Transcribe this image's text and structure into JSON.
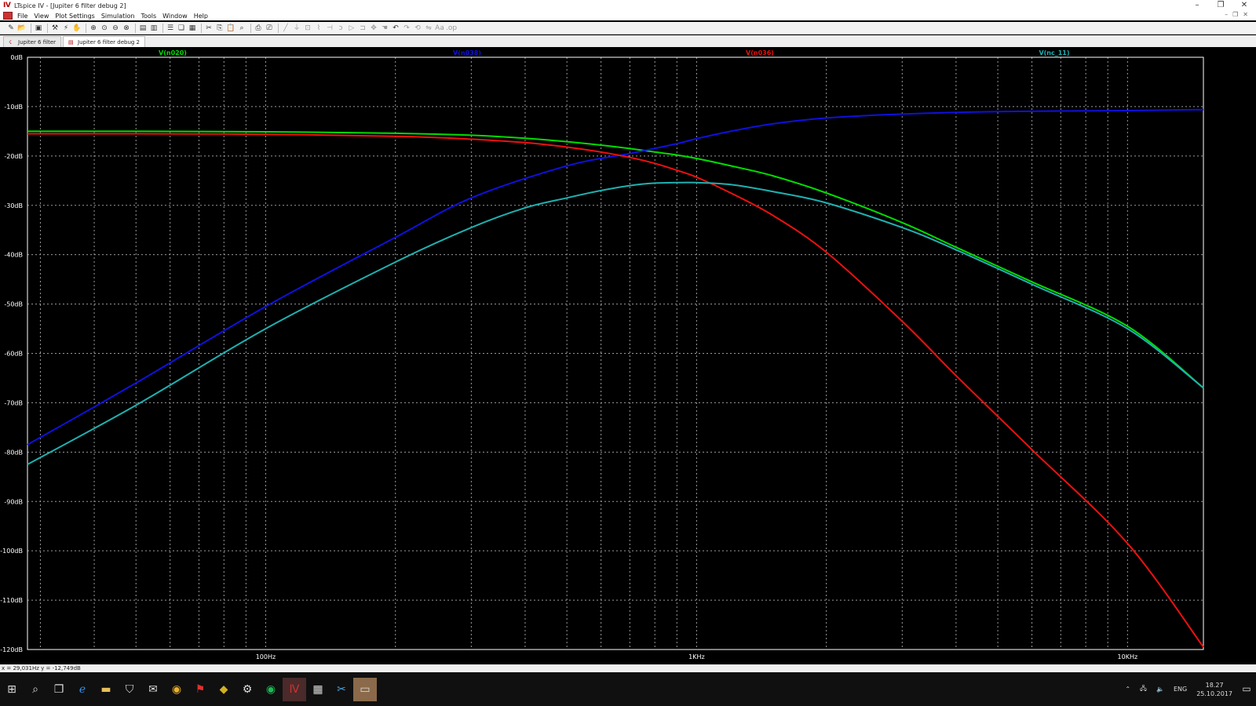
{
  "window": {
    "title": "LTspice IV - [Jupiter 6 filter debug 2]",
    "minimize": "–",
    "restore": "❐",
    "close": "✕"
  },
  "menu": [
    "File",
    "View",
    "Plot Settings",
    "Simulation",
    "Tools",
    "Window",
    "Help"
  ],
  "tabs": [
    {
      "label": "Jupiter 6 filter",
      "active": false
    },
    {
      "label": "Jupiter 6 filter debug 2",
      "active": true
    }
  ],
  "status": "x = 29,031Hz   y = -12,749dB",
  "taskbar": {
    "lang": "ENG",
    "time": "18.27",
    "date": "25.10.2017"
  },
  "chart_data": {
    "type": "line",
    "xscale": "log",
    "xlim": [
      28,
      15000
    ],
    "ylim": [
      -120,
      0
    ],
    "grid": true,
    "background": "#000000",
    "y_ticks": [
      "0dB",
      "-10dB",
      "-20dB",
      "-30dB",
      "-40dB",
      "-50dB",
      "-60dB",
      "-70dB",
      "-80dB",
      "-90dB",
      "-100dB",
      "-110dB",
      "-120dB"
    ],
    "y_tick_values": [
      0,
      -10,
      -20,
      -30,
      -40,
      -50,
      -60,
      -70,
      -80,
      -90,
      -100,
      -110,
      -120
    ],
    "x_ticks": [
      "100Hz",
      "1KHz",
      "10KHz"
    ],
    "x_tick_values": [
      100,
      1000,
      10000
    ],
    "series": [
      {
        "name": "V(n020)",
        "color": "#00dd00",
        "x": [
          28,
          50,
          100,
          200,
          300,
          400,
          500,
          600,
          700,
          800,
          900,
          1000,
          1200,
          1500,
          2000,
          3000,
          4000,
          6000,
          10000,
          15000
        ],
        "y": [
          -15.0,
          -15.0,
          -15.1,
          -15.4,
          -15.8,
          -16.4,
          -17.1,
          -17.8,
          -18.5,
          -19.2,
          -19.8,
          -20.5,
          -22.0,
          -24.0,
          -27.5,
          -33.5,
          -38.5,
          -45.5,
          -54.5,
          -67.0
        ]
      },
      {
        "name": "V(n038)",
        "color": "#1010dd",
        "x": [
          28,
          50,
          100,
          200,
          300,
          500,
          700,
          900,
          1000,
          1200,
          1500,
          2000,
          3000,
          5000,
          10000,
          15000
        ],
        "y": [
          -78.5,
          -66.0,
          -50.5,
          -36.5,
          -28.5,
          -22.0,
          -19.5,
          -17.5,
          -16.5,
          -15.0,
          -13.5,
          -12.3,
          -11.5,
          -11.0,
          -10.8,
          -10.6
        ]
      },
      {
        "name": "V(n036)",
        "color": "#ee1010",
        "x": [
          28,
          50,
          100,
          200,
          300,
          400,
          500,
          600,
          700,
          800,
          900,
          1000,
          1200,
          1500,
          2000,
          3000,
          4000,
          6000,
          10000,
          15000
        ],
        "y": [
          -15.5,
          -15.5,
          -15.6,
          -16.0,
          -16.6,
          -17.3,
          -18.2,
          -19.2,
          -20.3,
          -21.5,
          -22.9,
          -24.3,
          -27.5,
          -32.0,
          -39.5,
          -53.5,
          -64.5,
          -79.5,
          -98.5,
          -119.5
        ]
      },
      {
        "name": "V(nc_11)",
        "color": "#20b0b0",
        "x": [
          28,
          50,
          100,
          200,
          300,
          400,
          500,
          600,
          700,
          800,
          900,
          1000,
          1200,
          1500,
          2000,
          3000,
          4000,
          6000,
          10000,
          15000
        ],
        "y": [
          -82.5,
          -70.5,
          -55.0,
          -41.5,
          -34.5,
          -30.5,
          -28.5,
          -27.0,
          -26.0,
          -25.5,
          -25.4,
          -25.4,
          -25.8,
          -27.2,
          -29.5,
          -34.5,
          -39.0,
          -46.0,
          -55.0,
          -67.0
        ]
      }
    ]
  }
}
